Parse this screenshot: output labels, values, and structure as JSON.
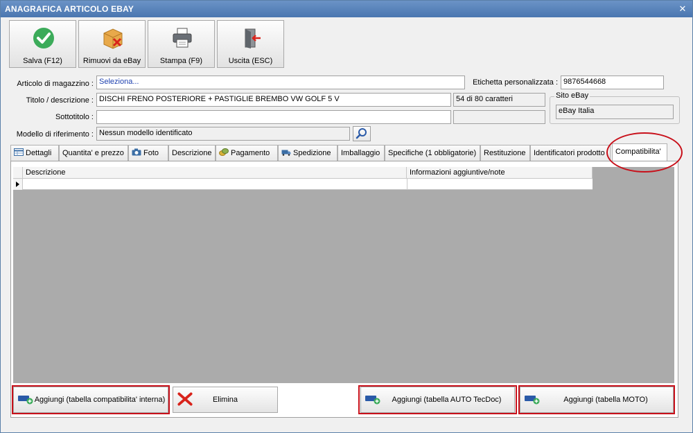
{
  "window": {
    "title": "ANAGRAFICA ARTICOLO EBAY",
    "close_glyph": "✕"
  },
  "toolbar": {
    "save_label": "Salva (F12)",
    "remove_label": "Rimuovi da eBay",
    "print_label": "Stampa (F9)",
    "exit_label": "Uscita (ESC)"
  },
  "form": {
    "articolo_label": "Articolo di magazzino :",
    "articolo_value": "Seleziona...",
    "etichetta_label": "Etichetta personalizzata :",
    "etichetta_value": "9876544668",
    "titolo_label": "Titolo / descrizione :",
    "titolo_value": "DISCHI FRENO POSTERIORE + PASTIGLIE BREMBO VW GOLF 5 V",
    "char_count": "54 di 80 caratteri",
    "sottotitolo_label": "Sottotitolo :",
    "sottotitolo_value": "",
    "modello_label": "Modello di riferimento :",
    "modello_value": "Nessun modello identificato",
    "sito_legend": "Sito eBay",
    "sito_value": "eBay Italia"
  },
  "tabs": [
    {
      "label": "Dettagli"
    },
    {
      "label": "Quantita' e prezzo"
    },
    {
      "label": "Foto"
    },
    {
      "label": "Descrizione"
    },
    {
      "label": "Pagamento"
    },
    {
      "label": "Spedizione"
    },
    {
      "label": "Imballaggio"
    },
    {
      "label": "Specifiche (1 obbligatorie)"
    },
    {
      "label": "Restituzione"
    },
    {
      "label": "Identificatori prodotto"
    },
    {
      "label": "Compatibilita'"
    }
  ],
  "grid": {
    "columns": [
      "Descrizione",
      "Informazioni aggiuntive/note"
    ]
  },
  "buttons": {
    "add_internal": "Aggiungi (tabella compatibilita' interna)",
    "delete": "Elimina",
    "add_tecdoc": "Aggiungi (tabella AUTO TecDoc)",
    "add_moto": "Aggiungi (tabella MOTO)"
  },
  "colors": {
    "accent": "#4a76b0",
    "highlight": "#c8101a",
    "ok_green": "#3cab5a"
  }
}
